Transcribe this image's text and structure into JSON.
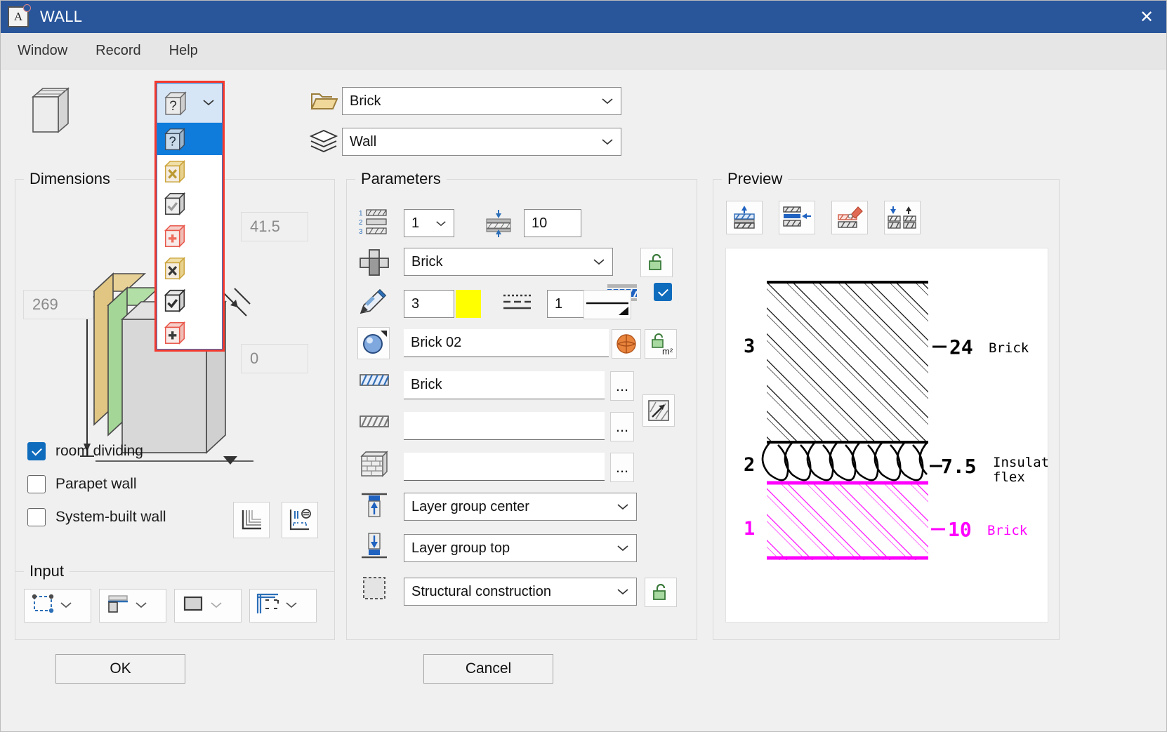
{
  "window": {
    "title": "WALL",
    "app_icon": "A",
    "close_label": "✕"
  },
  "menubar": {
    "items": [
      "Window",
      "Record",
      "Help"
    ]
  },
  "type_dropdown": {
    "open": true,
    "selected_icon": "question-cube-icon",
    "items": [
      {
        "icon": "question-cube-icon",
        "symbol": "?",
        "tone": "blue",
        "selected": true
      },
      {
        "icon": "cross-cube-gold-icon",
        "symbol": "✕",
        "tone": "gold",
        "selected": false
      },
      {
        "icon": "check-cube-gray-icon",
        "symbol": "✓",
        "tone": "gray",
        "selected": false
      },
      {
        "icon": "plus-cube-red-icon",
        "symbol": "+",
        "tone": "red",
        "selected": false
      },
      {
        "icon": "cross-cube-gold-dark-icon",
        "symbol": "✕",
        "tone": "gold-dark",
        "selected": false
      },
      {
        "icon": "check-cube-dark-icon",
        "symbol": "✓",
        "tone": "gray-dark",
        "selected": false
      },
      {
        "icon": "plus-cube-red-dark-icon",
        "symbol": "+",
        "tone": "red-dark",
        "selected": false
      }
    ]
  },
  "header": {
    "folder_value": "Brick",
    "layer_value": "Wall",
    "folder_icon": "folder-icon",
    "layer_icon": "layers-icon"
  },
  "dimensions": {
    "title": "Dimensions",
    "thickness_total": "269",
    "offset_value": "41.5",
    "zero_value": "0"
  },
  "options": {
    "room_dividing": {
      "label": "room dividing",
      "checked": true
    },
    "parapet_wall": {
      "label": "Parapet wall",
      "checked": false
    },
    "system_built_wall": {
      "label": "System-built wall",
      "checked": false
    },
    "buttons": [
      "wall-corner-icon",
      "wall-properties-icon"
    ]
  },
  "input": {
    "title": "Input",
    "buttons": [
      {
        "icon": "reference-line-icon"
      },
      {
        "icon": "wall-alignment-icon"
      },
      {
        "icon": "wall-solid-icon"
      },
      {
        "icon": "wall-connection-icon"
      }
    ]
  },
  "parameters": {
    "title": "Parameters",
    "layer_index": "1",
    "thickness": "10",
    "show_layer_checked": true,
    "fill_type": "Brick",
    "pen_width": "3",
    "pen_color": "#ffff00",
    "line_number": "1",
    "surface": "Brick 02",
    "hatch_top": "Brick",
    "hatch_bottom": "",
    "masonry": "",
    "ref_top": "Layer group center",
    "ref_bottom": "Layer group top",
    "construction": "Structural construction",
    "more_label": "...",
    "icons": {
      "layer_list": "numbered-layers-icon",
      "thickness": "thickness-icon",
      "visibility": "layer-visible-icon",
      "fill": "fill-type-icon",
      "pen": "pen-icon",
      "linetype": "line-type-icon",
      "surface": "surface-sphere-icon",
      "hatch_top": "hatch-blue-icon",
      "hatch_bottom": "hatch-gray-icon",
      "masonry": "masonry-icon",
      "ref_top": "ref-top-icon",
      "ref_bottom": "ref-bottom-icon",
      "construction": "construction-icon",
      "lock_fill": "unlock-green-icon",
      "lock_surface": "unlock-green-m2-icon",
      "lock_construction": "unlock-green-icon",
      "texture": "texture-link-icon",
      "material_ball": "material-ball-icon"
    }
  },
  "preview": {
    "title": "Preview",
    "toolbar": [
      {
        "icon": "layer-up-icon"
      },
      {
        "icon": "layer-insert-icon"
      },
      {
        "icon": "layer-paint-icon"
      },
      {
        "icon": "layer-swap-icon"
      }
    ],
    "layers": [
      {
        "number": "3",
        "thickness": "24",
        "name": "Brick",
        "pattern": "diagonal-hatch",
        "color": "#000000"
      },
      {
        "number": "2",
        "thickness": "7.5",
        "name": "Insulation\nflex",
        "pattern": "insulation-loops",
        "color": "#000000"
      },
      {
        "number": "1",
        "thickness": "10",
        "name": "Brick",
        "pattern": "diagonal-hatch",
        "color": "#ff00ff"
      }
    ]
  },
  "footer": {
    "ok_label": "OK",
    "cancel_label": "Cancel"
  }
}
